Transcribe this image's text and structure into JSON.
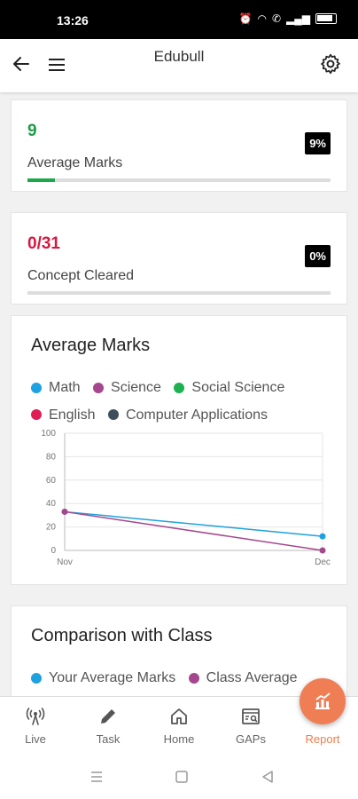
{
  "status_bar": {
    "time": "13:26"
  },
  "app_bar": {
    "title": "Edubull"
  },
  "stats": [
    {
      "value": "9",
      "label": "Average Marks",
      "badge": "9%",
      "progress_percent": 9,
      "value_color": "#1a9e48"
    },
    {
      "value": "0/31",
      "label": "Concept Cleared",
      "badge": "0%",
      "progress_percent": 0,
      "value_color": "#d9163f"
    }
  ],
  "average_marks_card": {
    "title": "Average Marks",
    "legend": [
      {
        "label": "Math",
        "color": "#1da1e0"
      },
      {
        "label": "Science",
        "color": "#a5478e"
      },
      {
        "label": "Social Science",
        "color": "#1fb14f"
      },
      {
        "label": "English",
        "color": "#e01e55"
      },
      {
        "label": "Computer Applications",
        "color": "#3d4f5c"
      }
    ]
  },
  "chart_data": {
    "type": "line",
    "x": [
      "Nov",
      "Dec"
    ],
    "ylim": [
      0,
      100
    ],
    "yticks": [
      "100",
      "80",
      "60",
      "40",
      "20",
      "0"
    ],
    "series": [
      {
        "name": "Math",
        "color": "#1da1e0",
        "values": [
          33,
          12
        ]
      },
      {
        "name": "Science",
        "color": "#a5478e",
        "values": [
          33,
          0
        ]
      }
    ]
  },
  "comparison_card": {
    "title": "Comparison with Class",
    "legend": [
      {
        "label": "Your Average Marks",
        "color": "#1da1e0"
      },
      {
        "label": "Class Average",
        "color": "#a5478e"
      }
    ]
  },
  "bottom_nav": [
    {
      "label": "Live",
      "icon": "live-icon"
    },
    {
      "label": "Task",
      "icon": "pencil-icon"
    },
    {
      "label": "Home",
      "icon": "home-icon"
    },
    {
      "label": "GAPs",
      "icon": "gaps-icon"
    },
    {
      "label": "Report",
      "icon": "report-icon",
      "active": true
    }
  ]
}
